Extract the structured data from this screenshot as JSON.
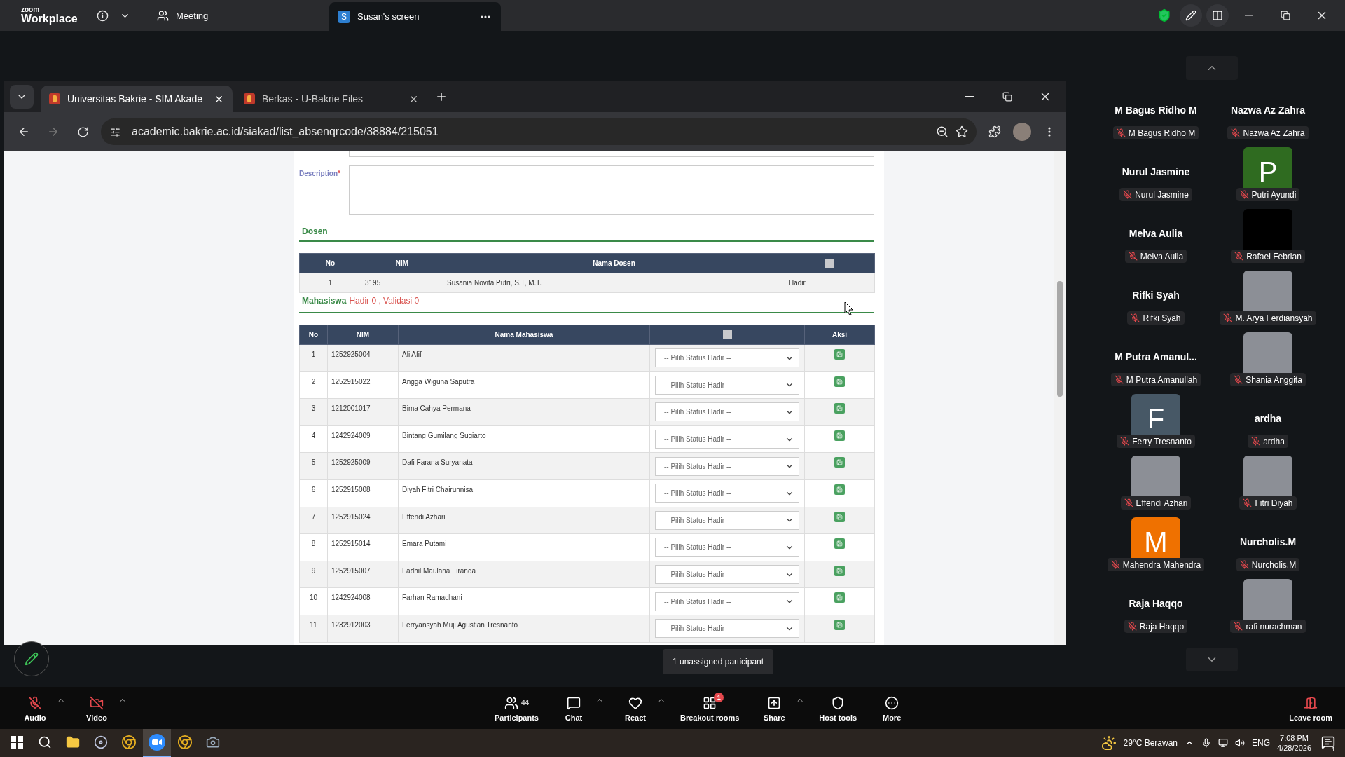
{
  "app_bar": {
    "logo_top": "zoom",
    "logo_bottom": "Workplace",
    "meeting_label": "Meeting",
    "share_tab": {
      "initial": "S",
      "label": "Susan's screen",
      "selected": true
    }
  },
  "browser": {
    "tabs": [
      {
        "title": "Universitas Bakrie - SIM Akade",
        "selected": true
      },
      {
        "title": "Berkas - U-Bakrie Files",
        "selected": false
      }
    ],
    "url": "academic.bakrie.ac.id/siakad/list_absenqrcode/38884/215051"
  },
  "form": {
    "description_label": "Description",
    "required_mark": "*"
  },
  "dosen": {
    "heading": "Dosen",
    "columns": [
      "No",
      "NIM",
      "Nama Dosen"
    ],
    "select_all": {
      "checked": false
    },
    "rows": [
      {
        "no": "1",
        "nim": "3195",
        "name": "Susania Novita Putri, S.T, M.T.",
        "status": "Hadir"
      }
    ]
  },
  "mahasiswa": {
    "heading": "Mahasiswa",
    "summary": "Hadir 0 , Validasi 0",
    "columns": [
      "No",
      "NIM",
      "Nama Mahasiswa"
    ],
    "select_all": {
      "checked": false
    },
    "action_column": "Aksi",
    "rows": [
      {
        "no": "1",
        "nim": "1252925004",
        "name": "Ali Afif",
        "status": "-- Pilih Status Hadir --"
      },
      {
        "no": "2",
        "nim": "1252915022",
        "name": "Angga Wiguna Saputra",
        "status": "-- Pilih Status Hadir --"
      },
      {
        "no": "3",
        "nim": "1212001017",
        "name": "Bima Cahya Permana",
        "status": "-- Pilih Status Hadir --"
      },
      {
        "no": "4",
        "nim": "1242924009",
        "name": "Bintang Gumilang Sugiarto",
        "status": "-- Pilih Status Hadir --"
      },
      {
        "no": "5",
        "nim": "1252925009",
        "name": "Dafi Farana Suryanata",
        "status": "-- Pilih Status Hadir --"
      },
      {
        "no": "6",
        "nim": "1252915008",
        "name": "Diyah Fitri Chairunnisa",
        "status": "-- Pilih Status Hadir --"
      },
      {
        "no": "7",
        "nim": "1252915024",
        "name": "Effendi Azhari",
        "status": "-- Pilih Status Hadir --"
      },
      {
        "no": "8",
        "nim": "1252915014",
        "name": "Emara Putami",
        "status": "-- Pilih Status Hadir --"
      },
      {
        "no": "9",
        "nim": "1252915007",
        "name": "Fadhil Maulana Firanda",
        "status": "-- Pilih Status Hadir --"
      },
      {
        "no": "10",
        "nim": "1242924008",
        "name": "Farhan Ramadhani",
        "status": "-- Pilih Status Hadir --"
      },
      {
        "no": "11",
        "nim": "1232912003",
        "name": "Ferryansyah Muji Agustian Tresnanto",
        "status": "-- Pilih Status Hadir --"
      }
    ]
  },
  "participants": [
    {
      "kind": "name",
      "display": "M Bagus Ridho M",
      "label": "M Bagus Ridho M",
      "muted": true
    },
    {
      "kind": "name",
      "display": "Nazwa Az Zahra",
      "label": "Nazwa Az Zahra",
      "muted": true
    },
    {
      "kind": "name",
      "display": "Nurul Jasmine",
      "label": "Nurul Jasmine",
      "muted": true
    },
    {
      "kind": "letter",
      "display": "P",
      "color": "#2f6b20",
      "label": "Putri Ayundi",
      "muted": true
    },
    {
      "kind": "name",
      "display": "Melva Aulia",
      "label": "Melva Aulia",
      "muted": true
    },
    {
      "kind": "video_off",
      "label": "Rafael Febrian",
      "muted": true
    },
    {
      "kind": "name",
      "display": "Rifki Syah",
      "label": "Rifki Syah",
      "muted": true
    },
    {
      "kind": "photo",
      "label": "M. Arya Ferdiansyah",
      "muted": true
    },
    {
      "kind": "name",
      "display": "M Putra Amanul...",
      "label": "M Putra Amanullah",
      "muted": true
    },
    {
      "kind": "photo",
      "label": "Shania Anggita",
      "muted": true
    },
    {
      "kind": "letter",
      "display": "F",
      "color": "#475866",
      "label": "Ferry Tresnanto",
      "muted": true
    },
    {
      "kind": "name",
      "display": "ardha",
      "label": "ardha",
      "muted": true
    },
    {
      "kind": "photo",
      "label": "Effendi Azhari",
      "muted": true
    },
    {
      "kind": "photo",
      "label": "Fitri Diyah",
      "muted": true
    },
    {
      "kind": "letter",
      "display": "M",
      "color": "#ef7100",
      "label": "Mahendra Mahendra",
      "muted": true
    },
    {
      "kind": "name",
      "display": "Nurcholis.M",
      "label": "Nurcholis.M",
      "muted": true
    },
    {
      "kind": "name",
      "display": "Raja Haqqo",
      "label": "Raja Haqqo",
      "muted": true
    },
    {
      "kind": "photo",
      "label": "rafi nurachman",
      "muted": true
    }
  ],
  "tooltip": "1 unassigned participant",
  "toolbar": [
    {
      "kind": "audio",
      "label": "Audio",
      "off": true,
      "caret": true
    },
    {
      "kind": "video",
      "label": "Video",
      "off": true,
      "caret": true
    },
    {
      "kind": "participants",
      "label": "Participants",
      "count": "44",
      "off": false,
      "caret": false
    },
    {
      "kind": "chat",
      "label": "Chat",
      "off": false,
      "caret": true
    },
    {
      "kind": "react",
      "label": "React",
      "off": false,
      "caret": true
    },
    {
      "kind": "breakout",
      "label": "Breakout rooms",
      "badge": "1",
      "off": false,
      "caret": false
    },
    {
      "kind": "share",
      "label": "Share",
      "off": false,
      "caret": true
    },
    {
      "kind": "host",
      "label": "Host tools",
      "off": false,
      "caret": false
    },
    {
      "kind": "more",
      "label": "More",
      "off": false,
      "caret": false
    },
    {
      "kind": "leave",
      "label": "Leave room",
      "off": false,
      "caret": false
    }
  ],
  "taskbar": {
    "apps": [
      {
        "kind": "start",
        "selected": false
      },
      {
        "kind": "search",
        "selected": false
      },
      {
        "kind": "explorer",
        "selected": false
      },
      {
        "kind": "app",
        "selected": false
      },
      {
        "kind": "chrome",
        "selected": false
      },
      {
        "kind": "zoom",
        "selected": true
      },
      {
        "kind": "chrome",
        "selected": false
      },
      {
        "kind": "camera",
        "selected": false
      }
    ],
    "weather": "29°C Berawan",
    "language": "ENG",
    "time": "7:08 PM",
    "date": "4/28/2026",
    "notifications": "1"
  }
}
